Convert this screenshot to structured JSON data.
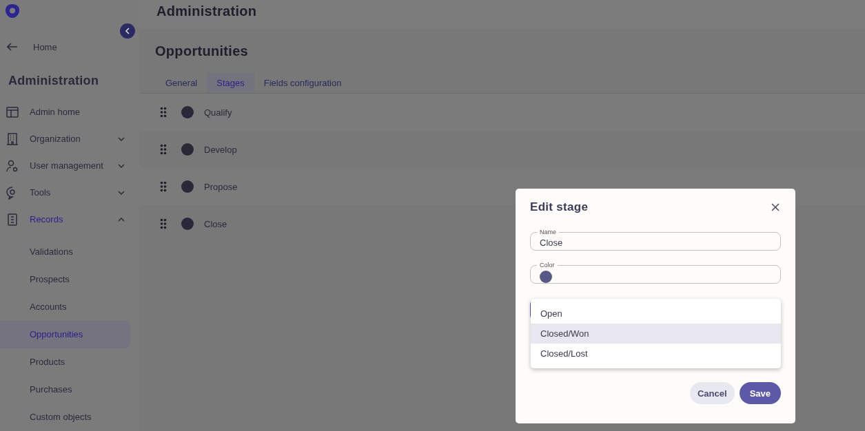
{
  "sidebar": {
    "back_link": "Home",
    "title": "Administration",
    "items": [
      {
        "label": "Admin home",
        "selected": false
      },
      {
        "label": "Organization",
        "expanded": false,
        "selected": false
      },
      {
        "label": "User management",
        "expanded": false,
        "selected": false
      },
      {
        "label": "Tools",
        "expanded": false,
        "selected": false
      },
      {
        "label": "Records",
        "expanded": true,
        "selected": true,
        "children": [
          {
            "label": "Validations",
            "selected": false
          },
          {
            "label": "Prospects",
            "selected": false
          },
          {
            "label": "Accounts",
            "selected": false
          },
          {
            "label": "Opportunities",
            "selected": true
          },
          {
            "label": "Products",
            "selected": false
          },
          {
            "label": "Purchases",
            "selected": false
          },
          {
            "label": "Custom objects",
            "selected": false
          }
        ]
      }
    ]
  },
  "header": {
    "title": "Administration"
  },
  "page": {
    "title": "Opportunities",
    "tabs": [
      {
        "label": "General",
        "selected": false
      },
      {
        "label": "Stages",
        "selected": true
      },
      {
        "label": "Fields configuration",
        "selected": false
      }
    ],
    "stages": [
      {
        "name": "Qualify"
      },
      {
        "name": "Develop"
      },
      {
        "name": "Propose"
      },
      {
        "name": "Close"
      }
    ]
  },
  "dialog": {
    "title": "Edit stage",
    "name_field": {
      "label": "Name",
      "value": "Close"
    },
    "color_field": {
      "label": "Color",
      "color": "#5a5985"
    },
    "type_options": [
      {
        "label": "Open",
        "selected": false
      },
      {
        "label": "Closed/Won",
        "selected": true
      },
      {
        "label": "Closed/Lost",
        "selected": false
      }
    ],
    "buttons": [
      {
        "label": "Cancel",
        "kind": "secondary"
      },
      {
        "label": "Save",
        "kind": "primary"
      }
    ]
  }
}
